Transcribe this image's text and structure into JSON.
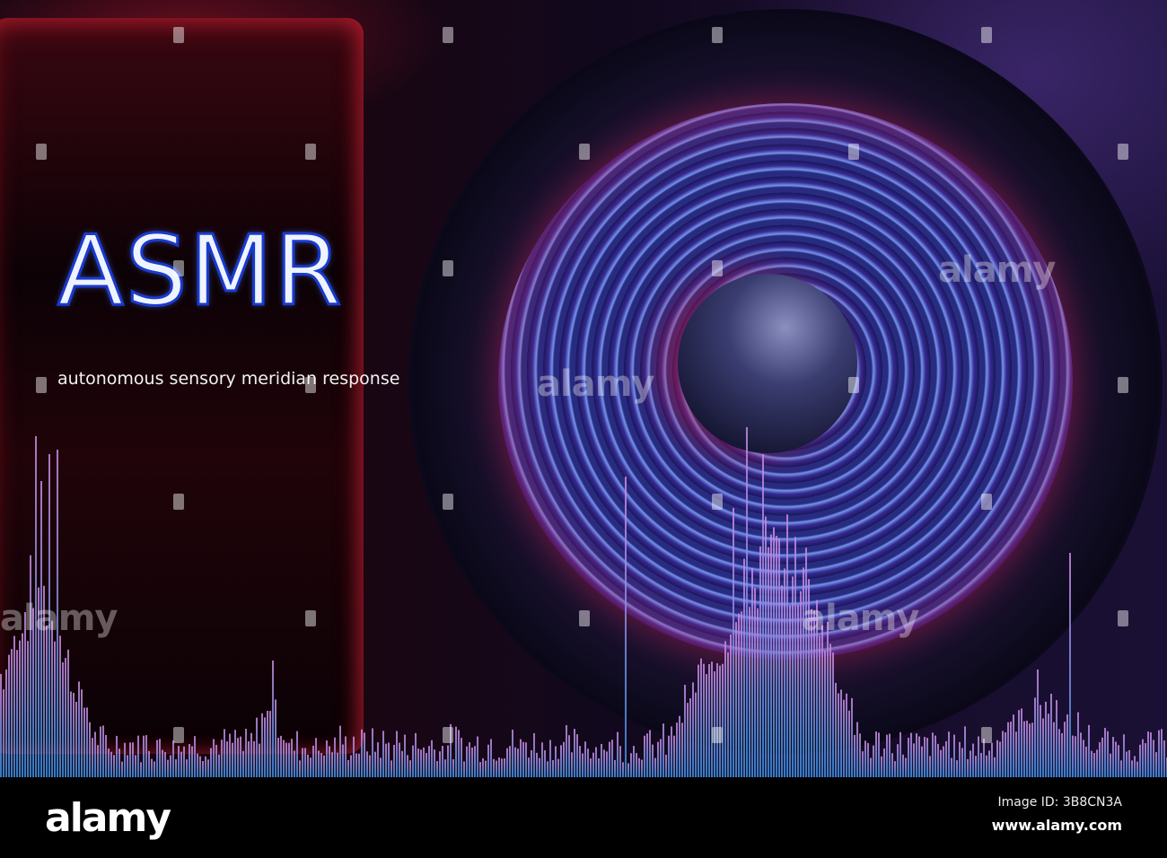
{
  "title": "ASMR",
  "subtitle": "autonomous sensory meridian response",
  "watermark": "alamy",
  "footer": {
    "logo": "alamy",
    "image_id": "Image ID: 3B8CN3A",
    "url": "www.alamy.com"
  },
  "colors": {
    "wave_top": "#c98ae0",
    "wave_bottom": "#3a8fe0",
    "title_stroke": "#1a3ad0"
  }
}
